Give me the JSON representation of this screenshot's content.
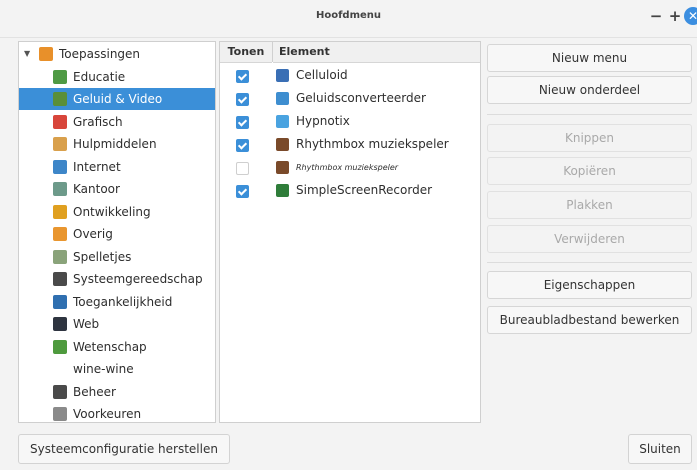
{
  "window": {
    "title": "Hoofdmenu"
  },
  "titlebar_buttons": {
    "minimize": "−",
    "maximize": "+",
    "close": "✕"
  },
  "categories": [
    {
      "label": "Toepassingen",
      "icon": "folder-orange-icon",
      "color": "#e8902a",
      "level": 0,
      "expanded": true
    },
    {
      "label": "Educatie",
      "icon": "education-icon",
      "color": "#4f9a44",
      "level": 1
    },
    {
      "label": "Geluid & Video",
      "icon": "multimedia-icon",
      "color": "#5a8f3b",
      "level": 1,
      "selected": true
    },
    {
      "label": "Grafisch",
      "icon": "graphics-icon",
      "color": "#d8453b",
      "level": 1
    },
    {
      "label": "Hulpmiddelen",
      "icon": "accessories-icon",
      "color": "#d9a04c",
      "level": 1
    },
    {
      "label": "Internet",
      "icon": "internet-icon",
      "color": "#3d86c8",
      "level": 1
    },
    {
      "label": "Kantoor",
      "icon": "office-icon",
      "color": "#6d9a8a",
      "level": 1
    },
    {
      "label": "Ontwikkeling",
      "icon": "development-icon",
      "color": "#e0a020",
      "level": 1
    },
    {
      "label": "Overig",
      "icon": "other-icon",
      "color": "#e9962f",
      "level": 1
    },
    {
      "label": "Spelletjes",
      "icon": "games-icon",
      "color": "#8aa37a",
      "level": 1
    },
    {
      "label": "Systeemgereedschap",
      "icon": "system-tools-icon",
      "color": "#4a4a4a",
      "level": 1
    },
    {
      "label": "Toegankelijkheid",
      "icon": "accessibility-icon",
      "color": "#2f6fb0",
      "level": 1
    },
    {
      "label": "Web",
      "icon": "web-icon",
      "color": "#2e3440",
      "level": 1
    },
    {
      "label": "Wetenschap",
      "icon": "science-icon",
      "color": "#4e9a3e",
      "level": 1
    },
    {
      "label": "wine-wine",
      "icon": "",
      "color": "",
      "level": 1
    },
    {
      "label": "Beheer",
      "icon": "administration-icon",
      "color": "#4a4a4a",
      "level": 1
    },
    {
      "label": "Voorkeuren",
      "icon": "preferences-icon",
      "color": "#8a8a8a",
      "level": 1
    }
  ],
  "element_columns": {
    "show": "Tonen",
    "element": "Element"
  },
  "elements": [
    {
      "label": "Celluloid",
      "checked": true,
      "icon": "celluloid-icon",
      "color": "#3a6fb5",
      "small": false
    },
    {
      "label": "Geluidsconverteerder",
      "checked": true,
      "icon": "sound-converter-icon",
      "color": "#3e8ed0",
      "small": false
    },
    {
      "label": "Hypnotix",
      "checked": true,
      "icon": "hypnotix-icon",
      "color": "#4aa3e0",
      "small": false
    },
    {
      "label": "Rhythmbox muziekspeler",
      "checked": true,
      "icon": "rhythmbox-icon",
      "color": "#7a4a2a",
      "small": false
    },
    {
      "label": "Rhythmbox muziekspeler",
      "checked": false,
      "icon": "rhythmbox-icon",
      "color": "#7a4a2a",
      "small": true
    },
    {
      "label": "SimpleScreenRecorder",
      "checked": true,
      "icon": "screen-recorder-icon",
      "color": "#2f7d3a",
      "small": false
    }
  ],
  "actions": {
    "new_menu": "Nieuw menu",
    "new_item": "Nieuw onderdeel",
    "cut": "Knippen",
    "copy": "Kopiëren",
    "paste": "Plakken",
    "delete": "Verwijderen",
    "properties": "Eigenschappen",
    "edit_desktop_file": "Bureaubladbestand bewerken"
  },
  "bottom": {
    "restore": "Systeemconfiguratie herstellen",
    "close": "Sluiten"
  }
}
